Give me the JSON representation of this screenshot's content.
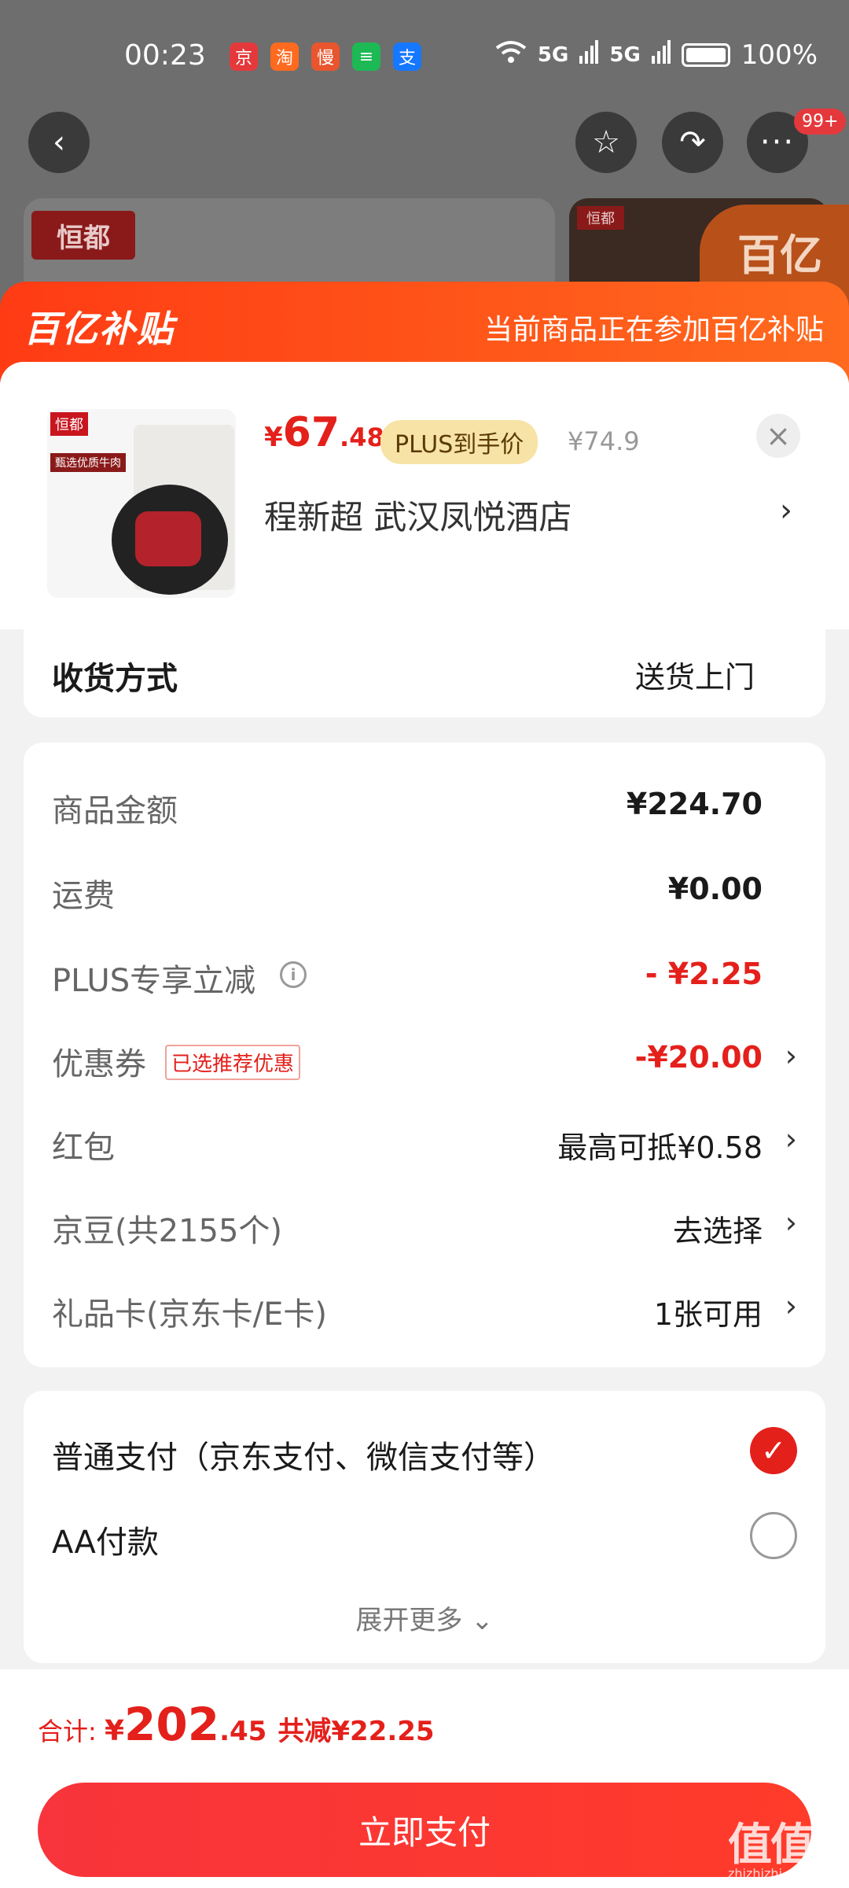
{
  "status_bar": {
    "time": "00:23",
    "notifications": [
      {
        "name": "jd-app-icon",
        "glyph": "京",
        "color": "#e4393c"
      },
      {
        "name": "taobao-icon",
        "glyph": "淘",
        "color": "#ff6a1e"
      },
      {
        "name": "manman-icon",
        "glyph": "慢",
        "color": "#e8552e"
      },
      {
        "name": "spotify-icon",
        "glyph": "≡",
        "color": "#1db954"
      },
      {
        "name": "alipay-icon",
        "glyph": "支",
        "color": "#1677ff"
      }
    ],
    "network_1": "5G",
    "network_2": "5G",
    "battery": "100%"
  },
  "top_nav": {
    "back_icon": "‹",
    "star_icon": "☆",
    "share_icon": "↷",
    "more_icon": "···",
    "more_badge": "99+"
  },
  "background": {
    "brand_left": "恒都",
    "brand_right": "恒都",
    "promo_text": "百亿"
  },
  "sheet": {
    "header_brand": "百亿补贴",
    "header_note": "当前商品正在参加百亿补贴"
  },
  "product": {
    "img_logo": "恒都",
    "img_tag": "甄选优质牛肉",
    "price_currency": "¥",
    "price_int": "67",
    "price_dec": ".48",
    "plus_label": "PLUS到手价",
    "original_price": "¥74.9",
    "close_icon": "×",
    "address": "程新超  武汉凤悦酒店",
    "address_chevron": "›"
  },
  "delivery": {
    "label": "收货方式",
    "value": "送货上门"
  },
  "costs": {
    "goods_label": "商品金额",
    "goods_value": "¥224.70",
    "shipping_label": "运费",
    "shipping_value": "¥0.00",
    "plus_discount_label": "PLUS专享立减",
    "plus_info_icon": "i",
    "plus_discount_value": "- ¥2.25",
    "coupon_label": "优惠券",
    "coupon_chip": "已选推荐优惠",
    "coupon_value": "-¥20.00",
    "redpacket_label": "红包",
    "redpacket_value": "最高可抵¥0.58",
    "jingdou_label": "京豆(共2155个)",
    "jingdou_value": "去选择",
    "giftcard_label": "礼品卡(京东卡/E卡)",
    "giftcard_value": "1张可用",
    "chevron": "›"
  },
  "payment": {
    "normal_label": "普通支付（京东支付、微信支付等）",
    "normal_selected": true,
    "check_icon": "✓",
    "aa_label": "AA付款",
    "aa_selected": false,
    "expand_label": "展开更多 ⌄"
  },
  "footer": {
    "total_label": "合计: ",
    "total_currency": "¥",
    "total_int": "202",
    "total_dec": ".45",
    "saved_label": "共减¥22.25",
    "pay_button": "立即支付"
  },
  "watermark": {
    "main": "值值值",
    "sub": "zhizhizhi.com"
  },
  "colors": {
    "accent_red": "#e4201b",
    "header_orange": "#ff4a18",
    "plus_gold": "#f7e3a5"
  }
}
